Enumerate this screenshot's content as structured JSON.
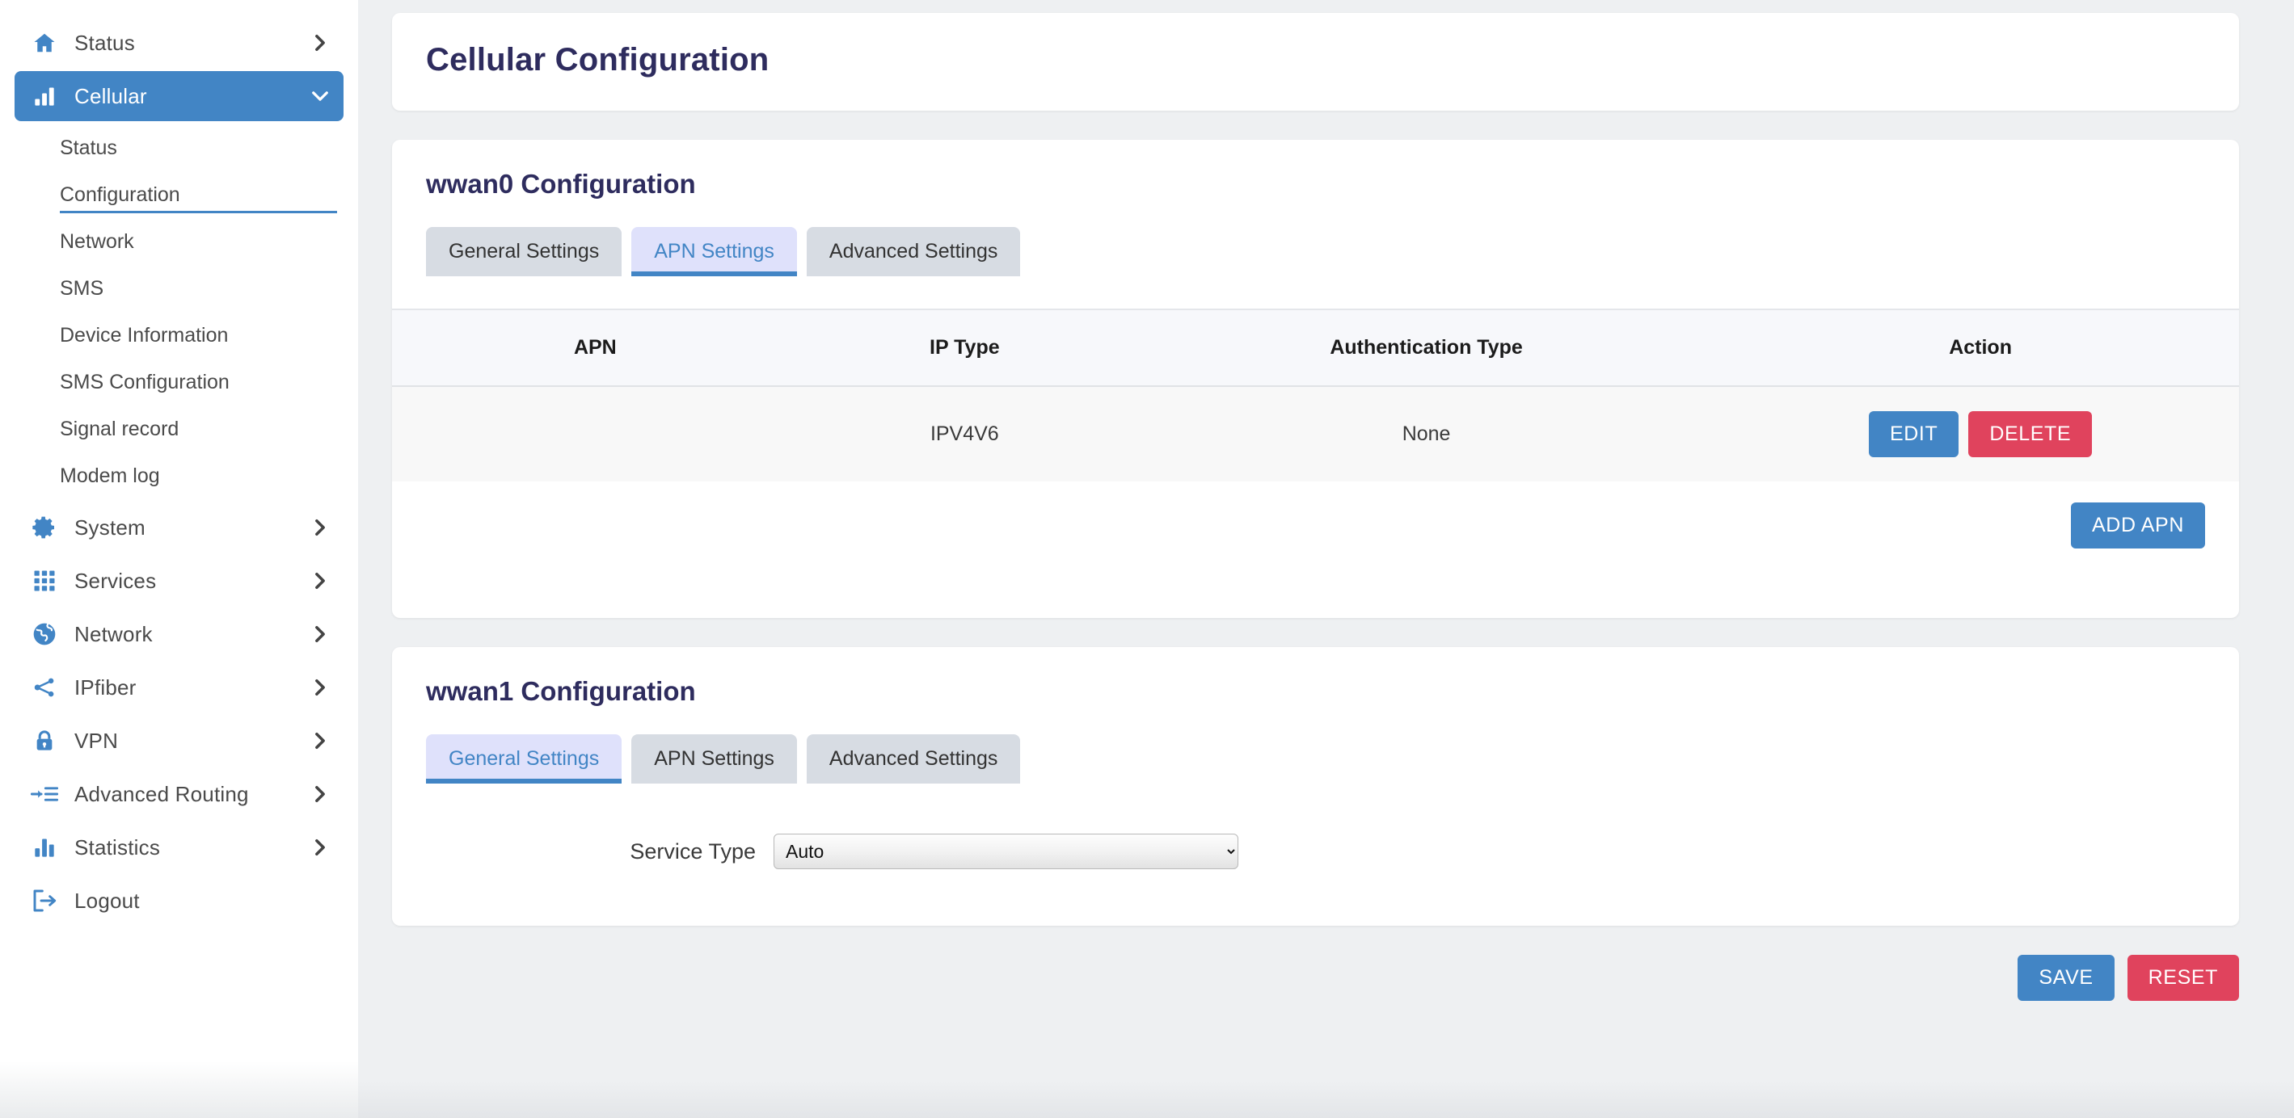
{
  "sidebar": {
    "items": [
      {
        "label": "Status",
        "icon": "home-icon",
        "chevron": "chevron-right",
        "active": false
      },
      {
        "label": "Cellular",
        "icon": "signal-bars-icon",
        "chevron": "chevron-down",
        "active": true
      }
    ],
    "cellular_sub_items": [
      {
        "label": "Status",
        "selected": false
      },
      {
        "label": "Configuration",
        "selected": true
      },
      {
        "label": "Network",
        "selected": false
      },
      {
        "label": "SMS",
        "selected": false
      },
      {
        "label": "Device Information",
        "selected": false
      },
      {
        "label": "SMS Configuration",
        "selected": false
      },
      {
        "label": "Signal record",
        "selected": false
      },
      {
        "label": "Modem log",
        "selected": false
      }
    ],
    "lower_items": [
      {
        "label": "System",
        "icon": "gear-icon",
        "chevron": "chevron-right"
      },
      {
        "label": "Services",
        "icon": "grid-apps-icon",
        "chevron": "chevron-right"
      },
      {
        "label": "Network",
        "icon": "globe-icon",
        "chevron": "chevron-right"
      },
      {
        "label": "IPfiber",
        "icon": "share-nodes-icon",
        "chevron": "chevron-right"
      },
      {
        "label": "VPN",
        "icon": "lock-icon",
        "chevron": "chevron-right"
      },
      {
        "label": "Advanced Routing",
        "icon": "route-list-icon",
        "chevron": "chevron-right"
      },
      {
        "label": "Statistics",
        "icon": "bar-chart-icon",
        "chevron": "chevron-right"
      },
      {
        "label": "Logout",
        "icon": "logout-icon",
        "chevron": ""
      }
    ]
  },
  "page": {
    "title": "Cellular Configuration"
  },
  "wwan0": {
    "title": "wwan0 Configuration",
    "tabs": [
      {
        "label": "General Settings",
        "active": false
      },
      {
        "label": "APN Settings",
        "active": true
      },
      {
        "label": "Advanced Settings",
        "active": false
      }
    ],
    "table": {
      "columns": [
        "APN",
        "IP Type",
        "Authentication Type",
        "Action"
      ],
      "rows": [
        {
          "apn": "",
          "ip_type": "IPV4V6",
          "auth_type": "None",
          "actions": [
            {
              "label": "EDIT",
              "style": "blue"
            },
            {
              "label": "DELETE",
              "style": "red"
            }
          ]
        }
      ],
      "add_button": "ADD APN"
    }
  },
  "wwan1": {
    "title": "wwan1 Configuration",
    "tabs": [
      {
        "label": "General Settings",
        "active": true
      },
      {
        "label": "APN Settings",
        "active": false
      },
      {
        "label": "Advanced Settings",
        "active": false
      }
    ],
    "form": {
      "service_type_label": "Service Type",
      "service_type_value": "Auto",
      "service_type_options": [
        "Auto"
      ]
    }
  },
  "footer": {
    "save_label": "SAVE",
    "reset_label": "RESET"
  },
  "colors": {
    "accent_blue": "#4285c5",
    "danger_red": "#e0435d",
    "heading_navy": "#2e2c5e",
    "tab_inactive_bg": "#d7dce3",
    "tab_active_bg": "#dfe1fb"
  }
}
